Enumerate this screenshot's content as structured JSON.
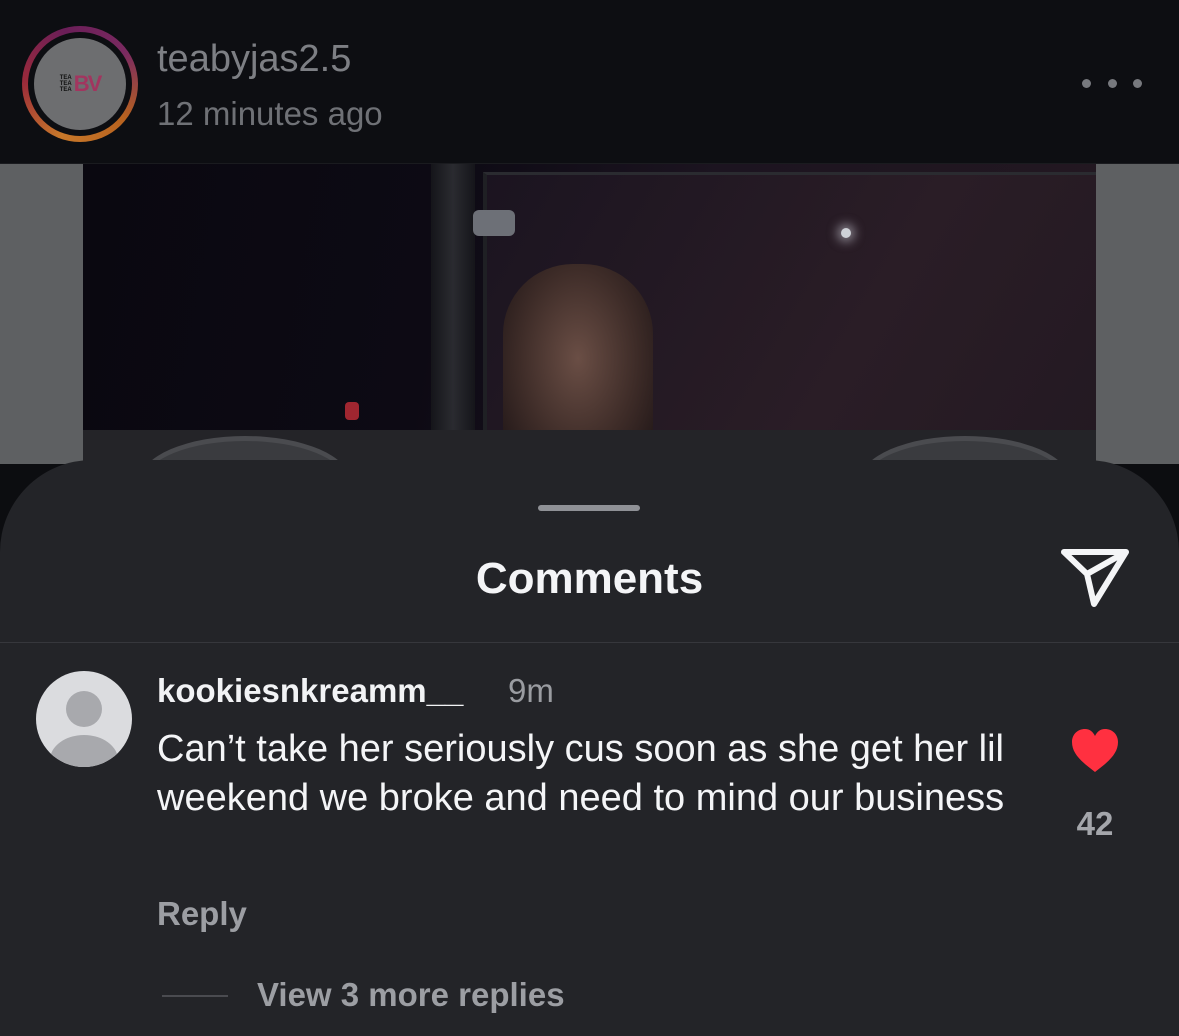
{
  "post": {
    "username": "teabyjas2.5",
    "timestamp": "12 minutes ago",
    "avatar_logo": {
      "stack": [
        "TEA",
        "TEA",
        "TEA"
      ],
      "mark": "BV"
    },
    "more_icon": "more-horizontal-icon"
  },
  "comments_sheet": {
    "title": "Comments",
    "share_icon": "send-paper-plane-icon",
    "comments": [
      {
        "username": "kookiesnkreamm__",
        "age": "9m",
        "text": "Can’t take her seriously cus soon as she get her lil weekend we broke and need to mind our business",
        "liked": true,
        "like_icon": "heart-filled-icon",
        "like_count": "42",
        "reply_label": "Reply",
        "view_replies_label": "View 3 more replies"
      }
    ]
  },
  "colors": {
    "background": "#0c0d10",
    "sheet": "#232428",
    "like_red": "#ff3040",
    "text_primary": "#f4f5f7",
    "text_secondary": "#9c9ea3"
  }
}
